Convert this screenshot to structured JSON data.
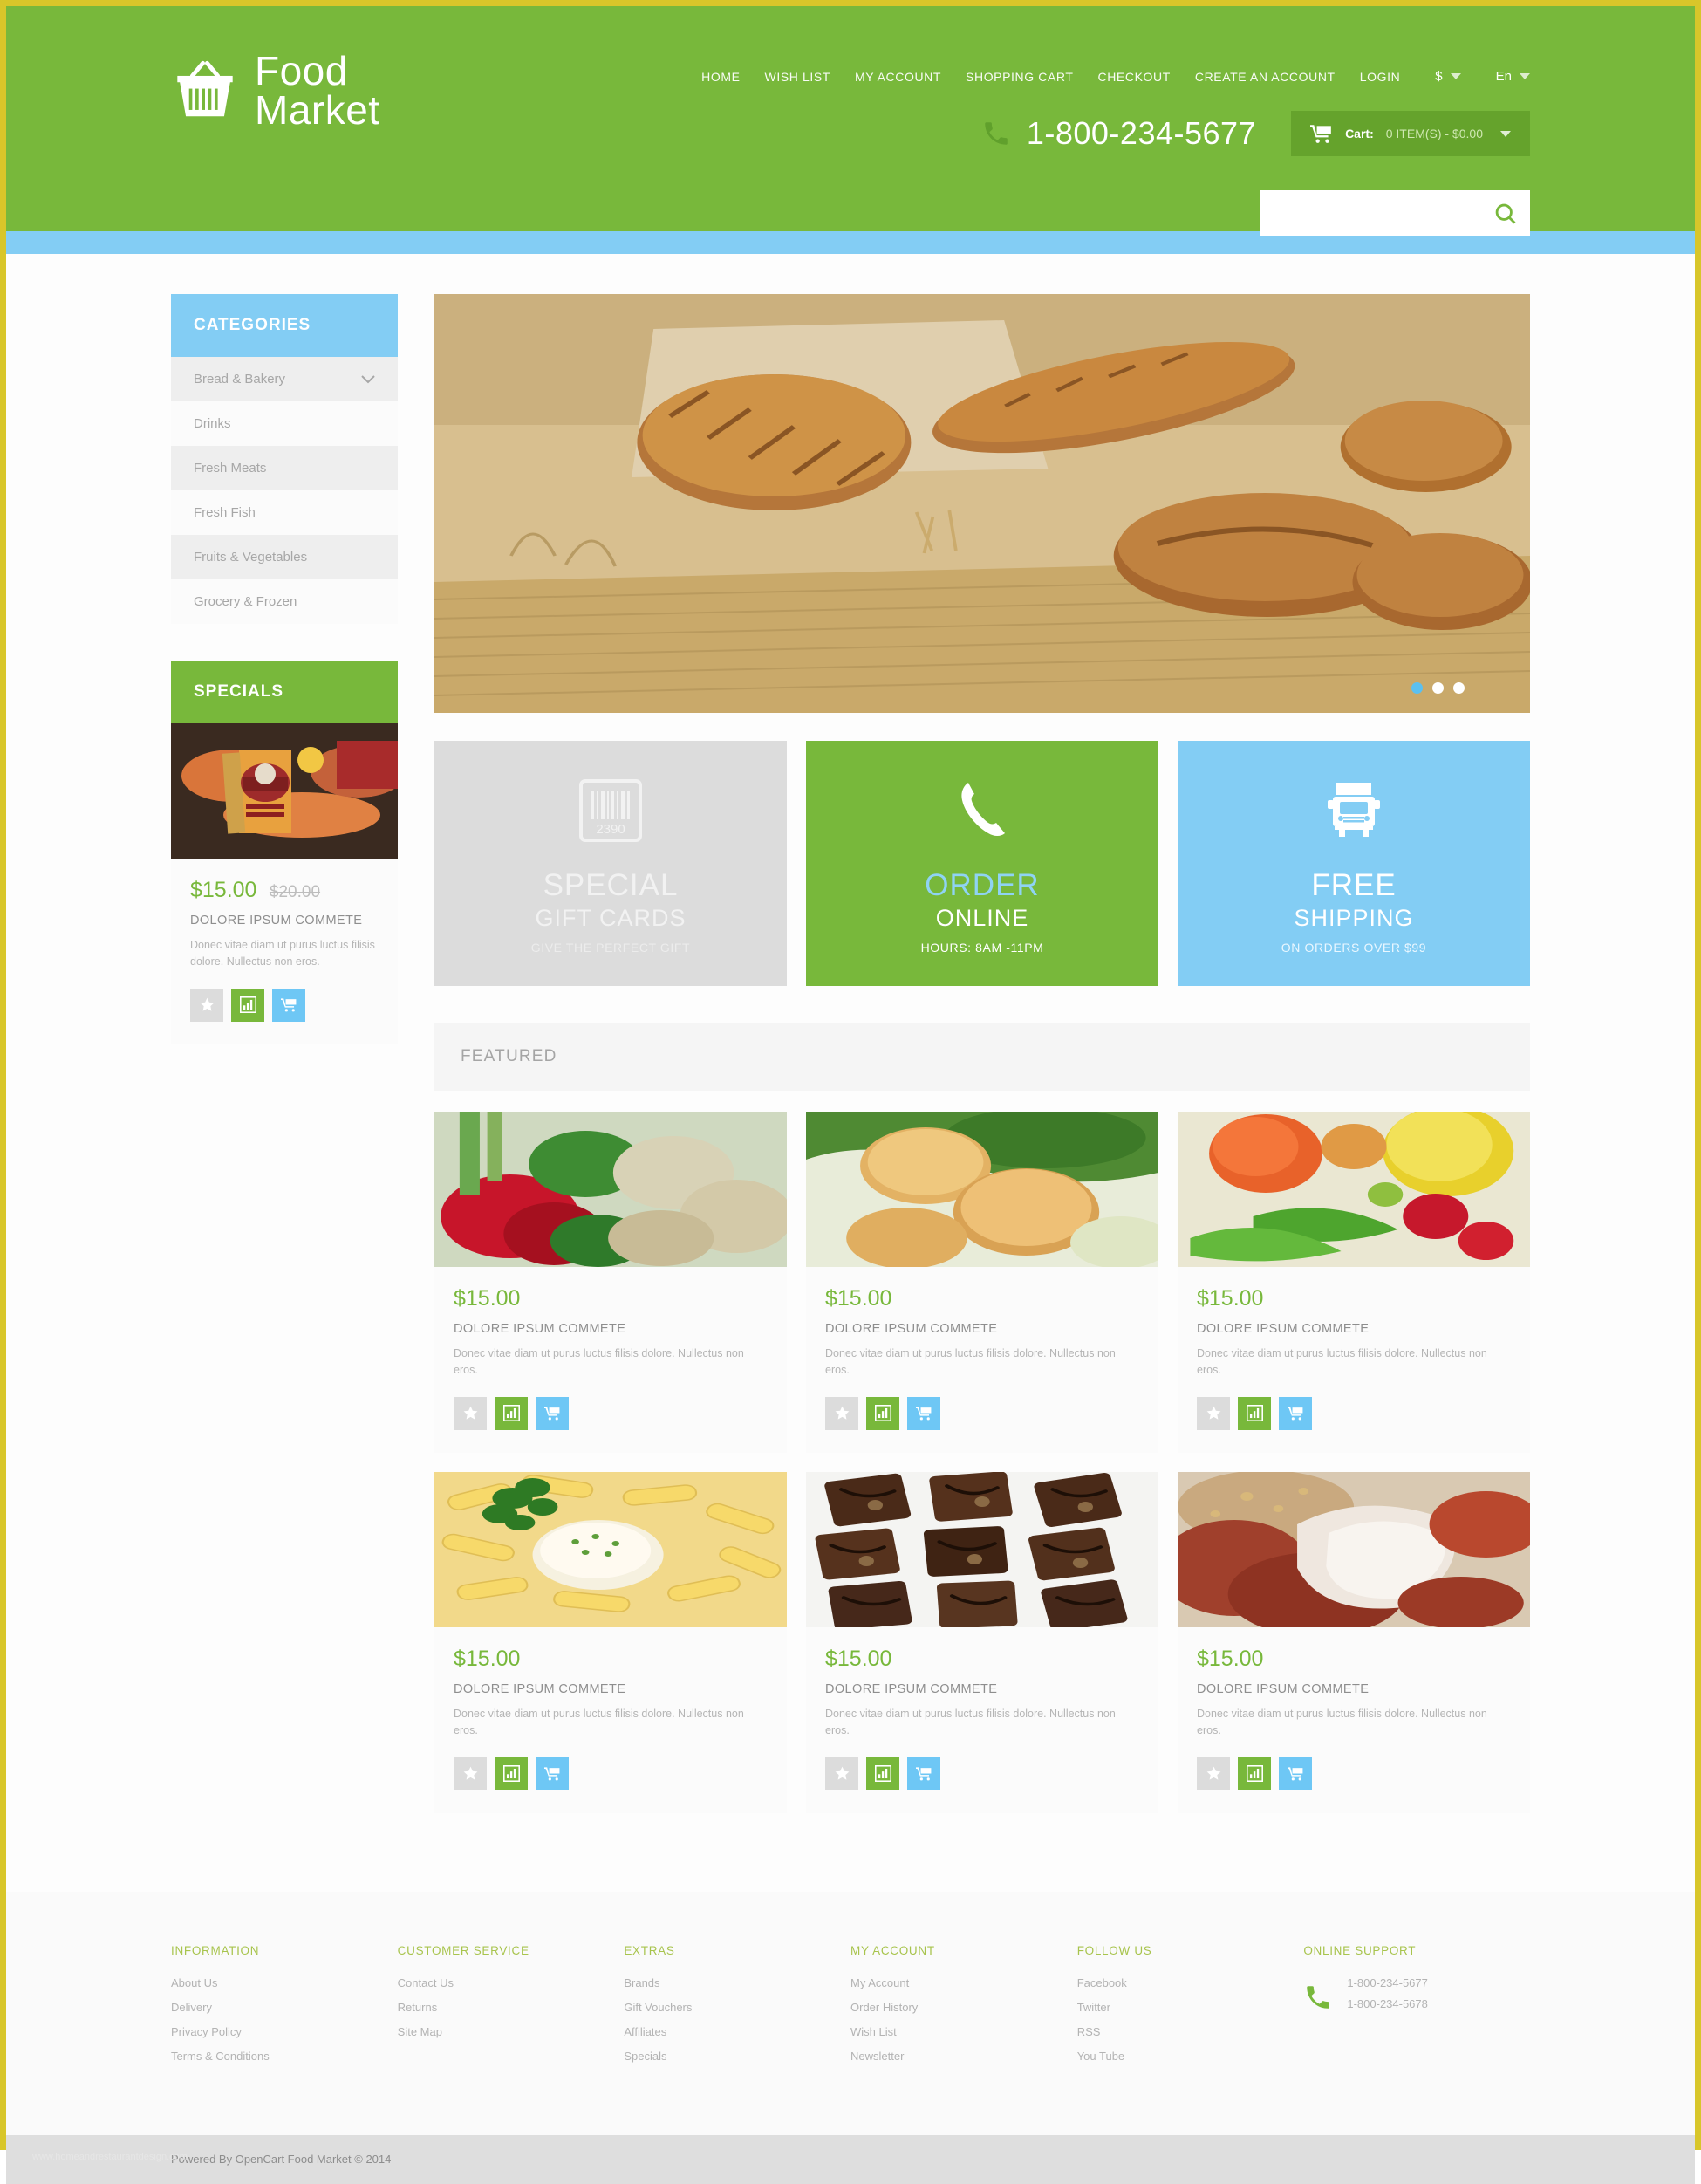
{
  "brand": {
    "name_line1": "Food",
    "name_line2": "Market",
    "logo_icon": "shopping-basket-icon"
  },
  "header": {
    "nav": [
      {
        "label": "HOME"
      },
      {
        "label": "WISH LIST"
      },
      {
        "label": "MY ACCOUNT"
      },
      {
        "label": "SHOPPING CART"
      },
      {
        "label": "CHECKOUT"
      },
      {
        "label": "CREATE AN ACCOUNT"
      },
      {
        "label": "LOGIN"
      }
    ],
    "currency": "$",
    "language": "En",
    "phone": "1-800-234-5677",
    "cart_label": "Cart:",
    "cart_value": "0 ITEM(S) - $0.00",
    "search_value": "",
    "search_placeholder": "",
    "bg_color": "#78b83b",
    "accent_blue": "#83cdf4"
  },
  "sidebar": {
    "categories_title": "CATEGORIES",
    "categories": [
      {
        "label": "Bread & Bakery",
        "has_chevron": true
      },
      {
        "label": "Drinks",
        "has_chevron": false
      },
      {
        "label": "Fresh Meats",
        "has_chevron": false
      },
      {
        "label": "Fresh Fish",
        "has_chevron": false
      },
      {
        "label": "Fruits & Vegetables",
        "has_chevron": false
      },
      {
        "label": "Grocery & Frozen",
        "has_chevron": false
      }
    ],
    "specials_title": "SPECIALS",
    "special_product": {
      "price": "$15.00",
      "price_old": "$20.00",
      "title": "DOLORE IPSUM COMMETE",
      "description": "Donec vitae diam ut purus luctus filisis dolore. Nullectus non eros.",
      "image_alt": "aidells-sausage-package"
    }
  },
  "slider": {
    "image_alt": "artisan-bread-loaves-on-bamboo-mat",
    "dots": [
      {
        "active": true
      },
      {
        "active": false
      },
      {
        "active": false
      }
    ]
  },
  "promos": [
    {
      "icon": "barcode-icon",
      "barcode_number": "2390",
      "line1": "SPECIAL",
      "line2": "GIFT CARDS",
      "line3": "GIVE THE PERFECT GIFT",
      "theme": "grey"
    },
    {
      "icon": "phone-handset-icon",
      "line1": "ORDER",
      "line2": "ONLINE",
      "line3": "HOURS: 8AM -11PM",
      "theme": "green"
    },
    {
      "icon": "delivery-truck-icon",
      "line1": "FREE",
      "line2": "SHIPPING",
      "line3": "ON ORDERS OVER $99",
      "theme": "blue"
    }
  ],
  "featured": {
    "title": "FEATURED",
    "products": [
      {
        "price": "$15.00",
        "title": "DOLORE IPSUM COMMETE",
        "description": "Donec vitae diam ut purus luctus filisis dolore. Nullectus non eros.",
        "image_alt": "fresh-peppers-and-vegetables"
      },
      {
        "price": "$15.00",
        "title": "DOLORE IPSUM COMMETE",
        "description": "Donec vitae diam ut purus luctus filisis dolore. Nullectus non eros.",
        "image_alt": "seared-scallops-on-greens"
      },
      {
        "price": "$15.00",
        "title": "DOLORE IPSUM COMMETE",
        "description": "Donec vitae diam ut purus luctus filisis dolore. Nullectus non eros.",
        "image_alt": "tomato-lemon-chili-radish"
      },
      {
        "price": "$15.00",
        "title": "DOLORE IPSUM COMMETE",
        "description": "Donec vitae diam ut purus luctus filisis dolore. Nullectus non eros.",
        "image_alt": "penne-pasta-with-parsley"
      },
      {
        "price": "$15.00",
        "title": "DOLORE IPSUM COMMETE",
        "description": "Donec vitae diam ut purus luctus filisis dolore. Nullectus non eros.",
        "image_alt": "chocolate-walnut-brownies"
      },
      {
        "price": "$15.00",
        "title": "DOLORE IPSUM COMMETE",
        "description": "Donec vitae diam ut purus luctus filisis dolore. Nullectus non eros.",
        "image_alt": "meat-dish-with-cream-sauce"
      }
    ],
    "actions": [
      {
        "name": "add-to-wishlist-button",
        "icon": "star-icon",
        "theme": "grey"
      },
      {
        "name": "compare-button",
        "icon": "bar-chart-icon",
        "theme": "green"
      },
      {
        "name": "add-to-cart-button",
        "icon": "cart-icon",
        "theme": "blue"
      }
    ]
  },
  "footer": {
    "columns": [
      {
        "title": "INFORMATION",
        "links": [
          "About Us",
          "Delivery",
          "Privacy Policy",
          "Terms & Conditions"
        ]
      },
      {
        "title": "CUSTOMER SERVICE",
        "links": [
          "Contact Us",
          "Returns",
          "Site Map"
        ]
      },
      {
        "title": "EXTRAS",
        "links": [
          "Brands",
          "Gift Vouchers",
          "Affiliates",
          "Specials"
        ]
      },
      {
        "title": "MY ACCOUNT",
        "links": [
          "My Account",
          "Order History",
          "Wish List",
          "Newsletter"
        ]
      },
      {
        "title": "FOLLOW US",
        "links": [
          "Facebook",
          "Twitter",
          "RSS",
          "You Tube"
        ]
      }
    ],
    "support_title": "ONLINE SUPPORT",
    "support_phones": [
      "1-800-234-5677",
      "1-800-234-5678"
    ],
    "copyright": "Powered By OpenCart Food Market © 2014",
    "watermark": "www.homeandrestaurantdesign.com"
  }
}
